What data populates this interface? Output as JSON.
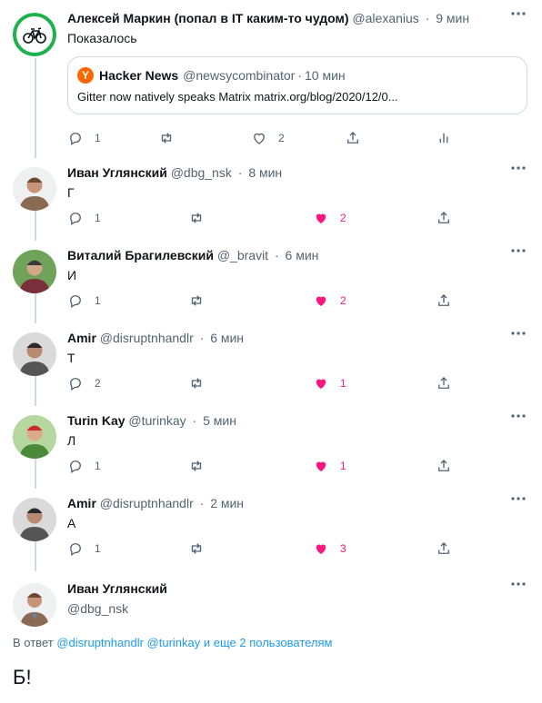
{
  "colors": {
    "like_active": "#f91880",
    "link": "#1d9bf0",
    "muted": "#536471",
    "line": "#cfd9de"
  },
  "main_tweet": {
    "name": "Алексей Маркин (попал в IT каким-то чудом)",
    "handle": "@alexanius",
    "time": "9 мин",
    "text": "Показалось",
    "avatar_icon": "bicycle-icon",
    "quote": {
      "name": "Hacker News",
      "handle": "@newsycombinator",
      "time": "10 мин",
      "logo": "Y",
      "text": "Gitter now natively speaks Matrix matrix.org/blog/2020/12/0..."
    },
    "replies": "1",
    "likes": "2"
  },
  "replies": [
    {
      "name": "Иван Углянский",
      "handle": "@dbg_nsk",
      "time": "8 мин",
      "text": "Г",
      "replies": "1",
      "likes": "2"
    },
    {
      "name": "Виталий Брагилевский",
      "handle": "@_bravit",
      "time": "6 мин",
      "text": "И",
      "replies": "1",
      "likes": "2"
    },
    {
      "name": "Amir",
      "handle": "@disruptnhandlr",
      "time": "6 мин",
      "text": "Т",
      "replies": "2",
      "likes": "1"
    },
    {
      "name": "Turin Kay",
      "handle": "@turinkay",
      "time": "5 мин",
      "text": "Л",
      "replies": "1",
      "likes": "1"
    },
    {
      "name": "Amir",
      "handle": "@disruptnhandlr",
      "time": "2 мин",
      "text": "А",
      "replies": "1",
      "likes": "3"
    }
  ],
  "composer": {
    "name": "Иван Углянский",
    "handle": "@dbg_nsk",
    "reply_prefix": "В ответ",
    "mention1": "@disruptnhandlr",
    "mention2": "@turinkay",
    "others": "и еще 2 пользователям",
    "text": "Б!"
  }
}
